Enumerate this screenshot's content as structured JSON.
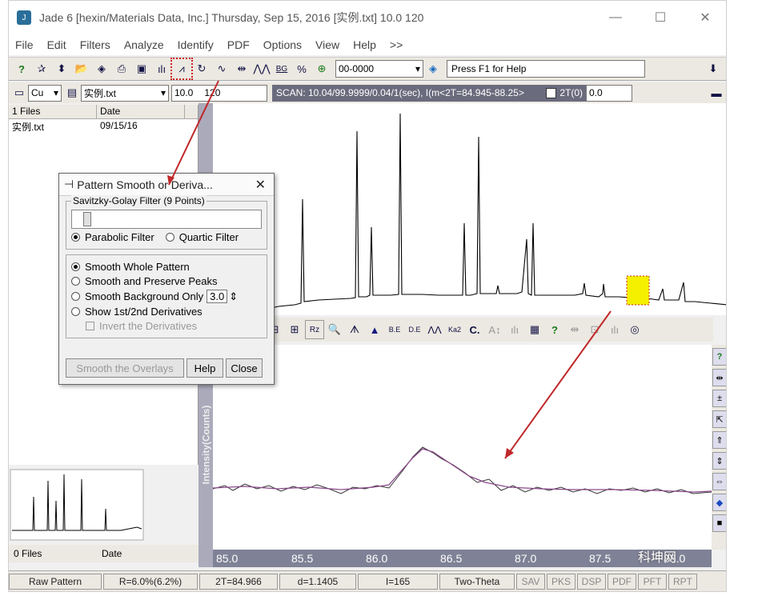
{
  "window": {
    "title": "Jade 6 [hexin/Materials Data, Inc.] Thursday, Sep 15, 2016 [实例.txt] 10.0    120",
    "app_glyph": "J"
  },
  "window_buttons": {
    "minimize": "—",
    "maximize": "☐",
    "close": "✕"
  },
  "menu": [
    "File",
    "Edit",
    "Filters",
    "Analyze",
    "Identify",
    "PDF",
    "Options",
    "View",
    "Help",
    ">>"
  ],
  "toolbar": {
    "pdf_value": "00-0000",
    "help_text": "Press F1 for Help",
    "buttons": [
      {
        "icon": "help-icon",
        "glyph": "?"
      },
      {
        "icon": "star-icon",
        "glyph": "✰"
      },
      {
        "icon": "updown-icon",
        "glyph": "⬍"
      },
      {
        "icon": "open-folder-icon",
        "glyph": "📂"
      },
      {
        "icon": "diamond-icon",
        "glyph": "◈"
      },
      {
        "icon": "print-icon",
        "glyph": "⎙"
      },
      {
        "icon": "save-icon",
        "glyph": "▣"
      },
      {
        "icon": "bars-icon",
        "glyph": "ılı"
      },
      {
        "icon": "smooth-icon",
        "glyph": "⩘"
      },
      {
        "icon": "cycle-icon",
        "glyph": "↻"
      },
      {
        "icon": "wave-icon",
        "glyph": "∿"
      },
      {
        "icon": "arrows-icon",
        "glyph": "⇹"
      },
      {
        "icon": "peaks-icon",
        "glyph": "⋀⋀"
      },
      {
        "icon": "bg-icon",
        "glyph": "BG"
      },
      {
        "icon": "percent-icon",
        "glyph": "%"
      },
      {
        "icon": "globe-icon",
        "glyph": "⊕"
      }
    ]
  },
  "toolbar2": {
    "anode": "Cu",
    "file": "实例.txt",
    "range_start": "10.0",
    "range_end": "120",
    "scan_info": "SCAN: 10.04/99.9999/0.04/1(sec), I(m<2T=84.945-88.25>",
    "twotheta_label": "2T(0)",
    "twotheta_value": "0.0"
  },
  "file_list": {
    "header": {
      "count": "1 Files",
      "date_col": "Date"
    },
    "rows": [
      {
        "name": "实例.txt",
        "date": "09/15/16"
      }
    ]
  },
  "file_list2": {
    "count": "0 Files",
    "date_col": "Date"
  },
  "dialog": {
    "title": "Pattern Smooth or Deriva...",
    "filter_group": "Savitzky-Golay Filter (9 Points)",
    "parabolic": "Parabolic Filter",
    "quartic": "Quartic Filter",
    "smooth_whole": "Smooth Whole Pattern",
    "smooth_preserve": "Smooth and Preserve Peaks",
    "smooth_background": "Smooth Background Only",
    "background_value": "3.0",
    "derivatives": "Show 1st/2nd Derivatives",
    "invert": "Invert the Derivatives",
    "btn_overlays": "Smooth the Overlays",
    "btn_help": "Help",
    "btn_close": "Close"
  },
  "mid_toolbar": [
    "⊟",
    "⊞",
    "Rz",
    "🔍",
    "ᗑ",
    "▲",
    "B.E",
    "D.E",
    "ΛΛ",
    "Ka2",
    "C.",
    "A↕",
    "ılı",
    "▦",
    "?",
    "⇹",
    "⊡",
    "ılı",
    "◎"
  ],
  "right_buttons": [
    "?",
    "⇹",
    "±",
    "⇱",
    "⇑",
    "⇕",
    "⇔",
    "◆",
    "■"
  ],
  "zoom_ylabel": "Intensity(Counts)",
  "xaxis_ticks": [
    "85.0",
    "85.5",
    "86.0",
    "86.5",
    "87.0",
    "87.5",
    "88.0"
  ],
  "status": [
    "Raw Pattern",
    "R=6.0%(6.2%)",
    "2T=84.966",
    "d=1.1405",
    "I=165",
    "Two-Theta",
    "SAV",
    "PKS",
    "DSP",
    "PDF",
    "PFT",
    "RPT"
  ],
  "watermark": "科坤网",
  "colors": {
    "accent_red": "#c0282a",
    "highlight_yellow": "#f5f000",
    "smooth_curve": "#8a4a8a",
    "scan_bar": "#6b6b7e"
  }
}
